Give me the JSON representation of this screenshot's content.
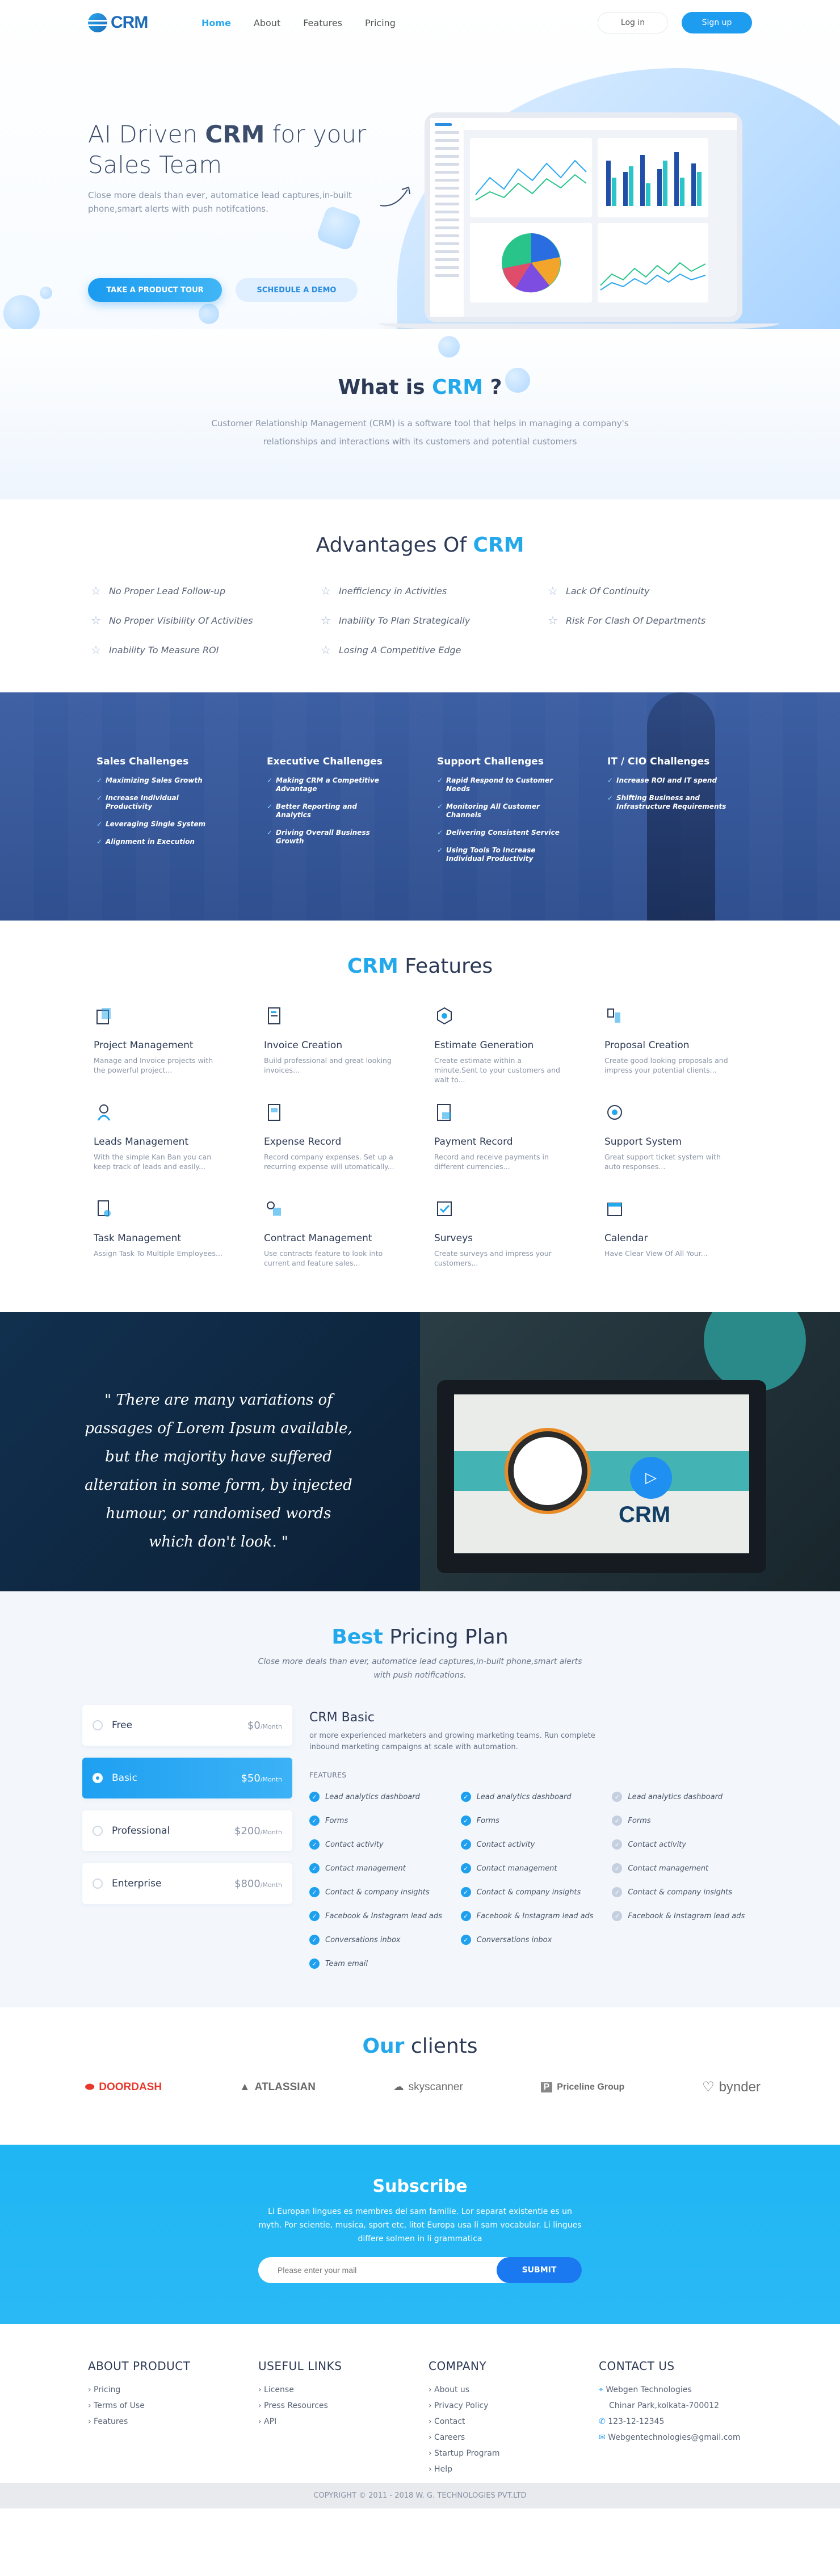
{
  "header": {
    "logo_text": "CRM",
    "nav": [
      "Home",
      "About",
      "Features",
      "Pricing"
    ],
    "login_label": "Log in",
    "signup_label": "Sign up"
  },
  "hero": {
    "title_prefix": "AI Driven ",
    "title_bold": "CRM",
    "title_suffix": " for your Sales Team",
    "subtitle": "Close more deals than ever, automatice lead captures,in-built phone,smart alerts with push notifcations.",
    "tour_button": "TAKE A PRODUCT TOUR",
    "demo_button": "SCHEDULE A DEMO"
  },
  "what": {
    "title_prefix": "What is ",
    "title_accent": "CRM",
    "title_suffix": " ?",
    "body": "Customer Relationship Management (CRM) is a software tool that helps in managing a company's relationships and interactions with its customers and potential customers"
  },
  "advantages": {
    "title_prefix": "Advantages Of ",
    "title_accent": "CRM",
    "items": [
      "No Proper Lead Follow-up",
      "Inefficiency in Activities",
      "Lack Of Continuity",
      "No Proper Visibility Of Activities",
      "Inability To Plan Strategically",
      "Risk For Clash Of Departments",
      "Inability To Measure ROI",
      "Losing A Competitive Edge"
    ]
  },
  "challenges": [
    {
      "title": "Sales Challenges",
      "items": [
        "Maximizing Sales Growth",
        "Increase Individual Productivity",
        "Leveraging Single System",
        "Alignment in Execution"
      ]
    },
    {
      "title": "Executive Challenges",
      "items": [
        "Making CRM a Competitive Advantage",
        "Better Reporting and Analytics",
        "Driving Overall Business Growth"
      ]
    },
    {
      "title": "Support Challenges",
      "items": [
        "Rapid Respond to Customer Needs",
        "Monitoring All Customer Channels",
        "Delivering Consistent Service",
        "Using Tools To Increase Individual Productivity"
      ]
    },
    {
      "title": "IT / CIO Challenges",
      "items": [
        "Increase ROI and IT spend",
        "Shifting Business and Infrastructure Requirements"
      ]
    }
  ],
  "features": {
    "title_accent": "CRM",
    "title_suffix": " Features",
    "items": [
      {
        "icon": "project-icon",
        "title": "Project Management",
        "desc": "Manage and Invoice projects with the powerful project..."
      },
      {
        "icon": "invoice-icon",
        "title": "Invoice Creation",
        "desc": "Build professional and great looking invoices..."
      },
      {
        "icon": "estimate-icon",
        "title": "Estimate Generation",
        "desc": "Create estimate within a minute.Sent to your customers and wait to..."
      },
      {
        "icon": "proposal-icon",
        "title": "Proposal Creation",
        "desc": "Create good looking proposals and impress your potential clients..."
      },
      {
        "icon": "leads-icon",
        "title": "Leads Management",
        "desc": "With the simple Kan Ban you can keep track of leads and easily..."
      },
      {
        "icon": "expense-icon",
        "title": "Expense Record",
        "desc": "Record company expenses. Set up a recurring expense will utomatically..."
      },
      {
        "icon": "payment-icon",
        "title": "Payment Record",
        "desc": "Record and receive payments in different currencies..."
      },
      {
        "icon": "support-icon",
        "title": "Support System",
        "desc": "Great support ticket system with auto responses..."
      },
      {
        "icon": "task-icon",
        "title": "Task Management",
        "desc": "Assign Task To Multiple Employees..."
      },
      {
        "icon": "contract-icon",
        "title": "Contract Management",
        "desc": "Use contracts feature to look into current and feature sales..."
      },
      {
        "icon": "survey-icon",
        "title": "Surveys",
        "desc": "Create surveys and impress your customers..."
      },
      {
        "icon": "calendar-icon",
        "title": "Calendar",
        "desc": "Have Clear View Of All Your..."
      }
    ]
  },
  "quote": {
    "text": "\" There are many variations of passages of Lorem Ipsum available, but the majority have suffered alteration in some form, by injected humour, or randomised words which don't look. \"",
    "video_logo": "CRM"
  },
  "pricing": {
    "title_accent": "Best",
    "title_suffix": " Pricing Plan",
    "subtitle": "Close more deals than ever, automatice lead captures,in-built phone,smart alerts with push notifications.",
    "plans": [
      {
        "name": "Free",
        "price": "$0",
        "period": "/Month",
        "active": false
      },
      {
        "name": "Basic",
        "price": "$50",
        "period": "/Month",
        "active": true
      },
      {
        "name": "Professional",
        "price": "$200",
        "period": "/Month",
        "active": false
      },
      {
        "name": "Enterprise",
        "price": "$800",
        "period": "/Month",
        "active": false
      }
    ],
    "detail_title": "CRM Basic",
    "detail_desc": "or more experienced marketers and growing marketing teams. Run complete inbound marketing campaigns at scale with automation.",
    "features_label": "FEATURES",
    "feature_cols": [
      [
        "Lead analytics dashboard",
        "Forms",
        "Contact activity",
        "Contact management",
        "Contact & company insights",
        "Facebook & Instagram lead ads",
        "Conversations inbox",
        "Team email"
      ],
      [
        "Lead analytics dashboard",
        "Forms",
        "Contact activity",
        "Contact management",
        "Contact & company insights",
        "Facebook & Instagram lead ads",
        "Conversations inbox"
      ],
      [
        "Lead analytics dashboard",
        "Forms",
        "Contact activity",
        "Contact management",
        "Contact & company insights",
        "Facebook & Instagram lead ads"
      ]
    ]
  },
  "clients": {
    "title_accent": "Our",
    "title_suffix": " clients",
    "logos": [
      "DOORDASH",
      "ATLASSIAN",
      "skyscanner",
      "Priceline Group",
      "bynder"
    ]
  },
  "subscribe": {
    "title": "Subscribe",
    "body": "Li Europan lingues es membres del sam familie. Lor separat existentie es un myth. Por scientie, musica, sport etc, litot Europa usa li sam vocabular. Li lingues differe solmen in li grammatica",
    "placeholder": "Please enter your mail",
    "button": "SUBMIT"
  },
  "footer": {
    "cols": [
      {
        "title": "ABOUT PRODUCT",
        "items": [
          "› Pricing",
          "› Terms of Use",
          "› Features"
        ]
      },
      {
        "title": "USEFUL LINKS",
        "items": [
          "› License",
          "› Press Resources",
          "› API"
        ]
      },
      {
        "title": "COMPANY",
        "items": [
          "› About us",
          "› Privacy Policy",
          "› Contact",
          "› Careers",
          "› Startup Program",
          "› Help"
        ]
      },
      {
        "title": "CONTACT US",
        "items": [
          "Webgen Technologies",
          "Chinar Park,kolkata-700012",
          "123-12-12345",
          "Webgentechnologies@gmail.com"
        ]
      }
    ],
    "copyright": "COPYRIGHT © 2011 - 2018 W. G. TECHNOLOGIES PVT.LTD"
  },
  "colors": {
    "accent": "#23a8ec",
    "primary": "#1d9cf0",
    "dark": "#2d3a55",
    "challenges_bg": "#3a5b9e",
    "subscribe_bg": "#1fb6f4"
  }
}
